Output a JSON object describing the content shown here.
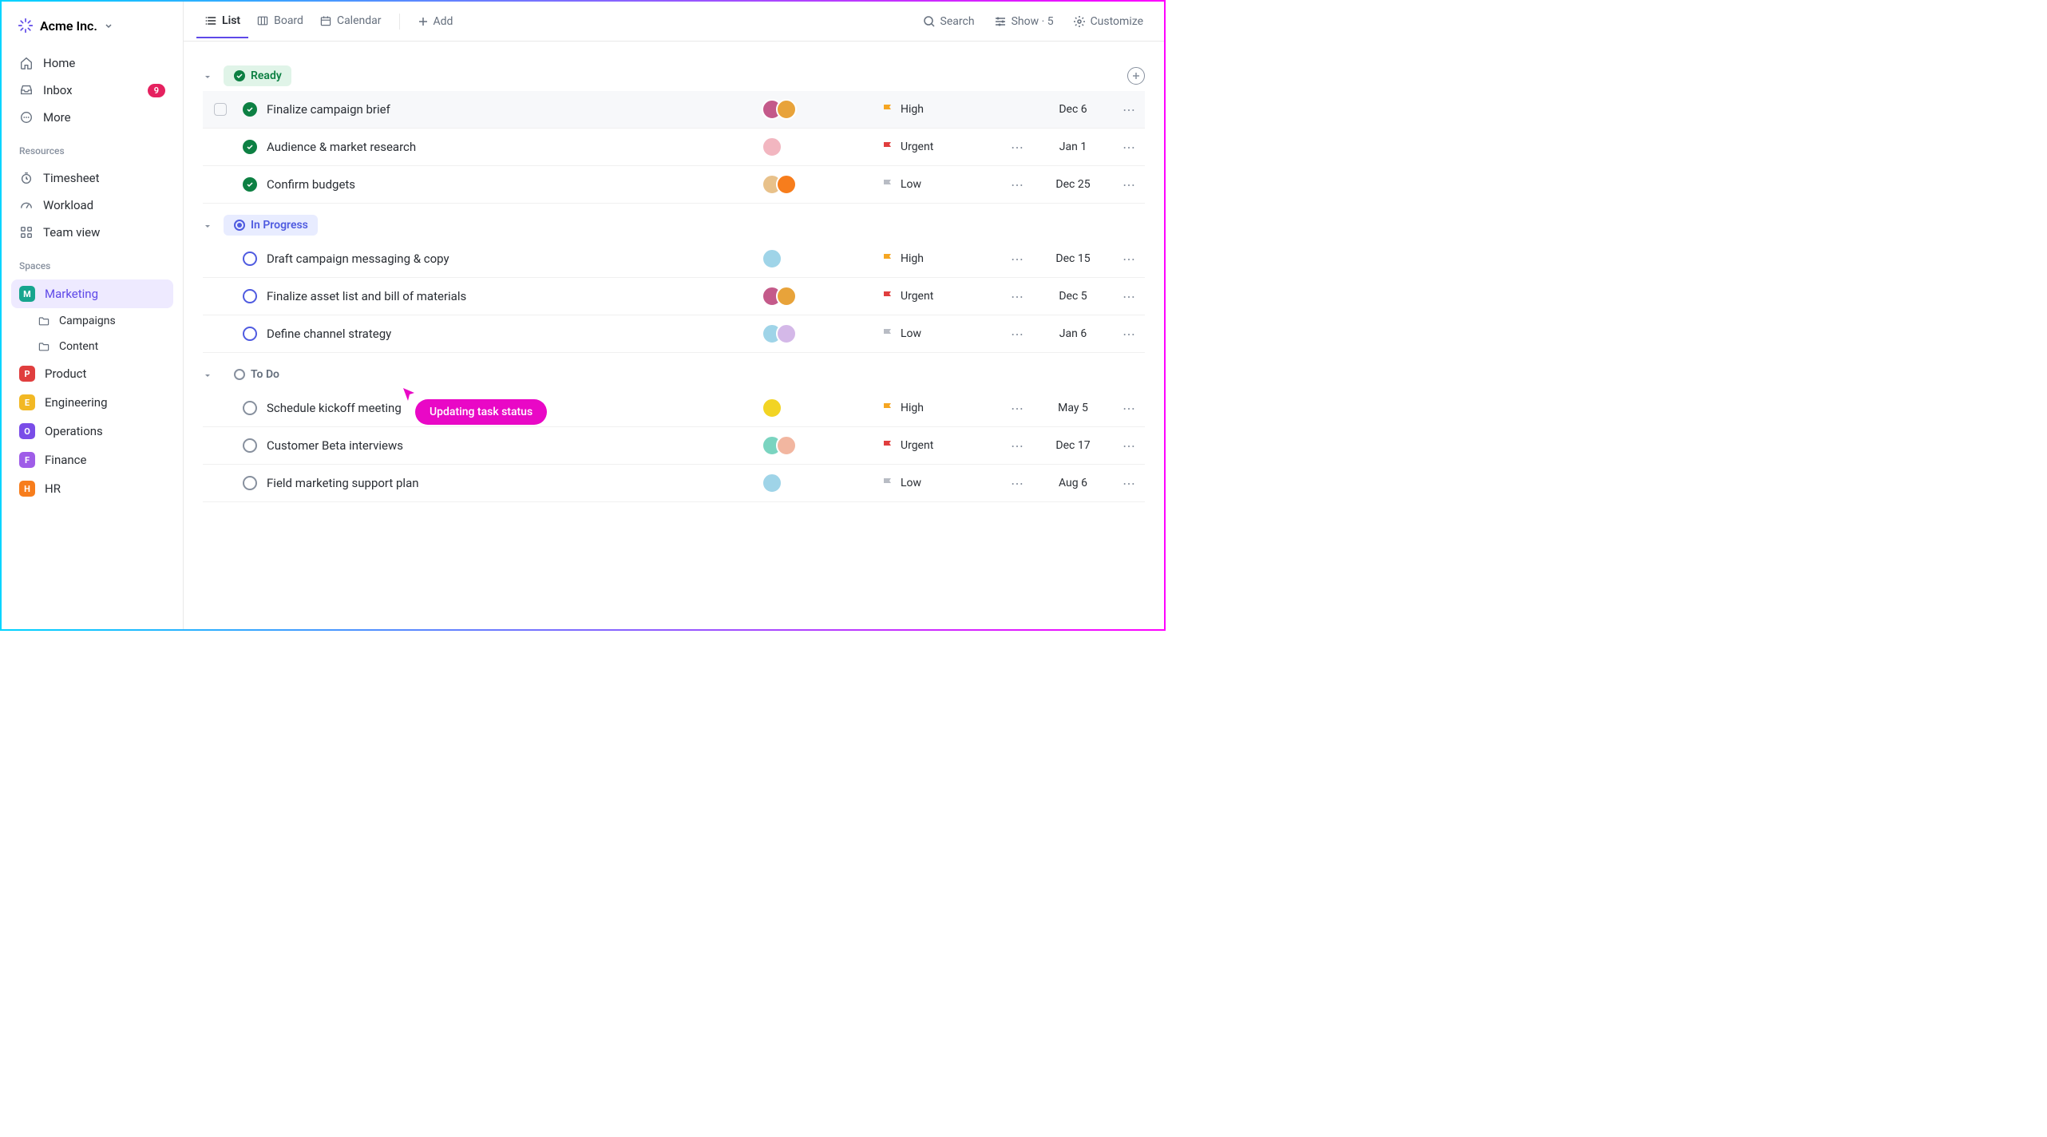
{
  "workspace": {
    "name": "Acme Inc."
  },
  "sidebar": {
    "nav": [
      {
        "label": "Home",
        "icon": "home"
      },
      {
        "label": "Inbox",
        "icon": "inbox",
        "badge": "9"
      },
      {
        "label": "More",
        "icon": "more"
      }
    ],
    "resources_label": "Resources",
    "resources": [
      {
        "label": "Timesheet",
        "icon": "timer"
      },
      {
        "label": "Workload",
        "icon": "gauge"
      },
      {
        "label": "Team view",
        "icon": "grid"
      }
    ],
    "spaces_label": "Spaces",
    "spaces": [
      {
        "label": "Marketing",
        "letter": "M",
        "color": "#17a58e",
        "active": true,
        "children": [
          {
            "label": "Campaigns"
          },
          {
            "label": "Content"
          }
        ]
      },
      {
        "label": "Product",
        "letter": "P",
        "color": "#e03e3e"
      },
      {
        "label": "Engineering",
        "letter": "E",
        "color": "#f2b824"
      },
      {
        "label": "Operations",
        "letter": "O",
        "color": "#7a4de8"
      },
      {
        "label": "Finance",
        "letter": "F",
        "color": "#9f5de8"
      },
      {
        "label": "HR",
        "letter": "H",
        "color": "#f77d1c"
      }
    ]
  },
  "topbar": {
    "views": [
      {
        "label": "List",
        "active": true
      },
      {
        "label": "Board"
      },
      {
        "label": "Calendar"
      }
    ],
    "add_label": "Add",
    "search_label": "Search",
    "show_label": "Show · 5",
    "customize_label": "Customize"
  },
  "groups": [
    {
      "status": "Ready",
      "style": "ready",
      "tasks": [
        {
          "name": "Finalize campaign brief",
          "assignees": [
            "#c45a8a",
            "#e8a33a"
          ],
          "priority": "High",
          "flag": "#f5a623",
          "date": "Dec 6",
          "show_checkbox": true,
          "done": true,
          "show_meta": false,
          "hovered": true
        },
        {
          "name": "Audience & market research",
          "assignees": [
            "#f2b6c0"
          ],
          "priority": "Urgent",
          "flag": "#e03e3e",
          "date": "Jan 1",
          "done": true,
          "show_meta": true
        },
        {
          "name": "Confirm budgets",
          "assignees": [
            "#e8c18a",
            "#f77d1c"
          ],
          "priority": "Low",
          "flag": "#b8bcc4",
          "date": "Dec 25",
          "done": true,
          "show_meta": true
        }
      ]
    },
    {
      "status": "In Progress",
      "style": "progress",
      "tasks": [
        {
          "name": "Draft campaign messaging & copy",
          "assignees": [
            "#9fd4e8"
          ],
          "priority": "High",
          "flag": "#f5a623",
          "date": "Dec 15",
          "show_meta": true
        },
        {
          "name": "Finalize asset list and bill of materials",
          "assignees": [
            "#c45a8a",
            "#e8a33a"
          ],
          "priority": "Urgent",
          "flag": "#e03e3e",
          "date": "Dec 5",
          "show_meta": true
        },
        {
          "name": "Define channel strategy",
          "assignees": [
            "#9fd4e8",
            "#d4b8e8"
          ],
          "priority": "Low",
          "flag": "#b8bcc4",
          "date": "Jan 6",
          "show_meta": true
        }
      ]
    },
    {
      "status": "To Do",
      "style": "todo",
      "tasks": [
        {
          "name": "Schedule kickoff meeting",
          "assignees": [
            "#f2d424"
          ],
          "priority": "High",
          "flag": "#f5a623",
          "date": "May 5",
          "show_meta": true
        },
        {
          "name": "Customer Beta interviews",
          "assignees": [
            "#7ad4c0",
            "#f2b6a0"
          ],
          "priority": "Urgent",
          "flag": "#e03e3e",
          "date": "Dec 17",
          "show_meta": true
        },
        {
          "name": "Field marketing support plan",
          "assignees": [
            "#9fd4e8"
          ],
          "priority": "Low",
          "flag": "#b8bcc4",
          "date": "Aug 6",
          "show_meta": true
        }
      ]
    }
  ],
  "tooltip": {
    "text": "Updating task status"
  }
}
